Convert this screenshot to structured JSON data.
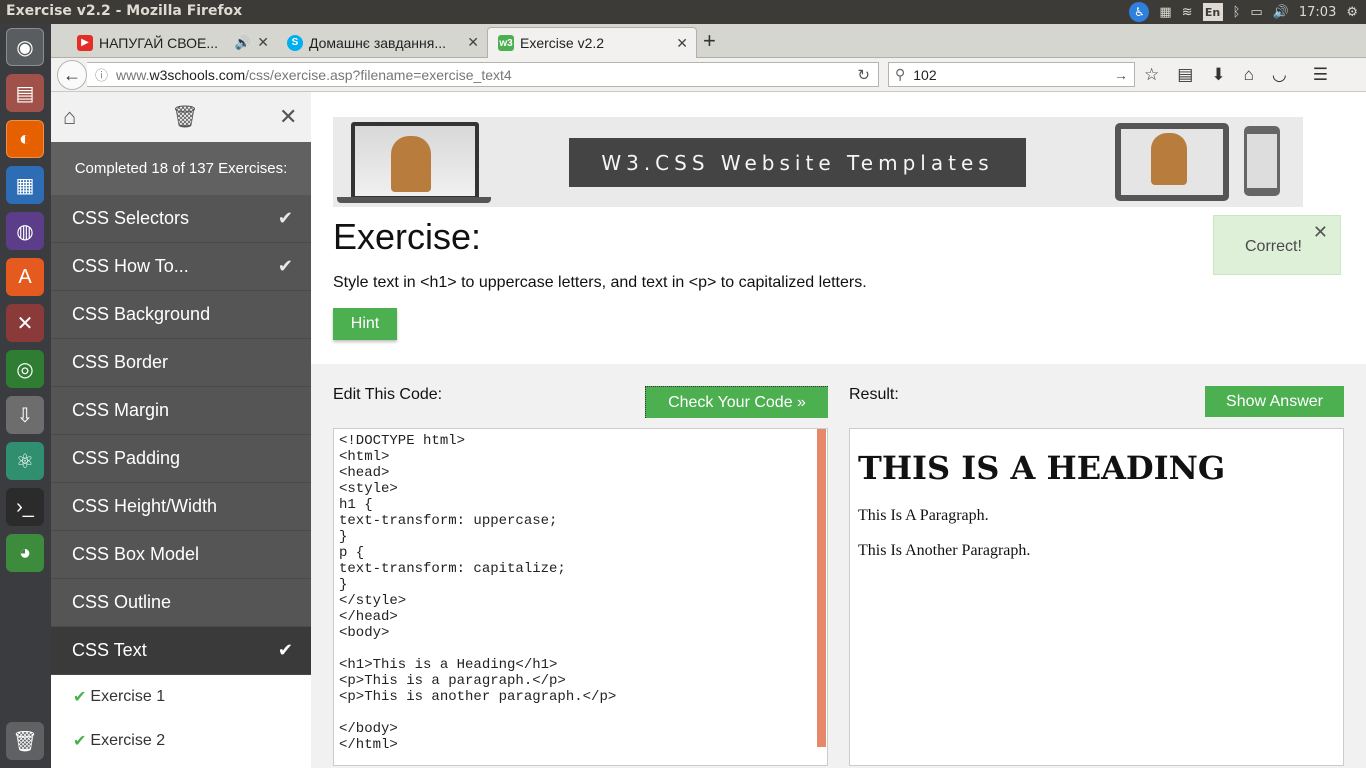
{
  "os_panel": {
    "window_title": "Exercise v2.2 - Mozilla Firefox",
    "keyboard_layout": "En",
    "clock": "17:03"
  },
  "launcher": {
    "items": [
      "ubuntu-dash-icon",
      "files-icon",
      "firefox-icon",
      "libreoffice-writer-icon",
      "eclipse-icon",
      "software-center-icon",
      "system-settings-icon",
      "chrome-icon",
      "update-manager-icon",
      "atom-icon",
      "terminal-icon",
      "network-globe-icon",
      "trash-icon"
    ]
  },
  "tabs": [
    {
      "label": "НАПУГАЙ СВОЕ...",
      "icon": "youtube-icon",
      "color": "#e52d27"
    },
    {
      "label": "Домашнє завдання...",
      "icon": "skype-icon",
      "color": "#00aff0"
    },
    {
      "label": "Exercise v2.2",
      "icon": "w3schools-icon",
      "color": "#4caf50"
    }
  ],
  "url": {
    "prefix": "www.",
    "domain": "w3schools.com",
    "path": "/css/exercise.asp?filename=exercise_text4"
  },
  "search": {
    "value": "102"
  },
  "sidebar": {
    "progress": "Completed 18 of 137 Exercises:",
    "items": [
      {
        "label": "CSS Selectors",
        "completed": true
      },
      {
        "label": "CSS How To...",
        "completed": true
      },
      {
        "label": "CSS Background",
        "completed": false
      },
      {
        "label": "CSS Border",
        "completed": false
      },
      {
        "label": "CSS Margin",
        "completed": false
      },
      {
        "label": "CSS Padding",
        "completed": false
      },
      {
        "label": "CSS Height/Width",
        "completed": false
      },
      {
        "label": "CSS Box Model",
        "completed": false
      },
      {
        "label": "CSS Outline",
        "completed": false
      },
      {
        "label": "CSS Text",
        "completed": true
      }
    ],
    "sub_items": [
      "Exercise 1",
      "Exercise 2"
    ]
  },
  "banner": {
    "text": "W3.CSS Website Templates"
  },
  "exercise": {
    "title": "Exercise:",
    "description": "Style text in <h1> to uppercase letters, and text in <p> to capitalized letters.",
    "hint_label": "Hint",
    "correct_label": "Correct!"
  },
  "editor": {
    "label": "Edit This Code:",
    "check_label": "Check Your Code »",
    "code": "<!DOCTYPE html>\n<html>\n<head>\n<style>\nh1 {\ntext-transform: uppercase;\n}\np {\ntext-transform: capitalize;\n}\n</style>\n</head>\n<body>\n\n<h1>This is a Heading</h1>\n<p>This is a paragraph.</p>\n<p>This is another paragraph.</p>\n\n</body>\n</html>"
  },
  "result": {
    "label": "Result:",
    "answer_label": "Show Answer",
    "heading": "This is a Heading",
    "paragraphs": [
      "This is a paragraph.",
      "This is another paragraph."
    ]
  }
}
